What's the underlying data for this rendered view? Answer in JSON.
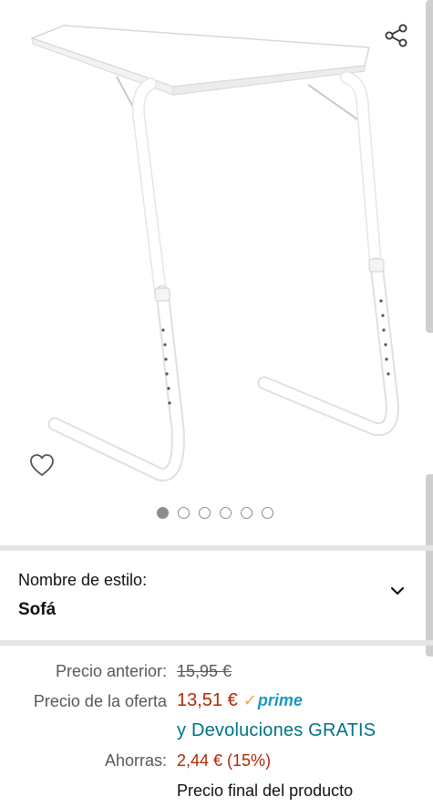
{
  "product": {
    "image_alt": "Mesa plegable blanca ajustable",
    "carousel": {
      "count": 6,
      "active": 0
    }
  },
  "icons": {
    "share": "share-icon",
    "wishlist": "heart-icon",
    "chevron": "chevron-down-icon"
  },
  "style_selector": {
    "label": "Nombre de estilo:",
    "value": "Sofá"
  },
  "pricing": {
    "previous_label": "Precio anterior:",
    "previous_value": "15,95 €",
    "offer_label": "Precio de la oferta",
    "offer_value": "13,51 €",
    "prime_label": "prime",
    "free_returns": "y Devoluciones GRATIS",
    "savings_label": "Ahorras:",
    "savings_value": "2,44 € (15%)",
    "final_note": "Precio final del producto"
  },
  "colors": {
    "price_red": "#b12704",
    "link_teal": "#007185",
    "prime_blue": "#1a98c4",
    "divider": "#e3e6e6"
  }
}
